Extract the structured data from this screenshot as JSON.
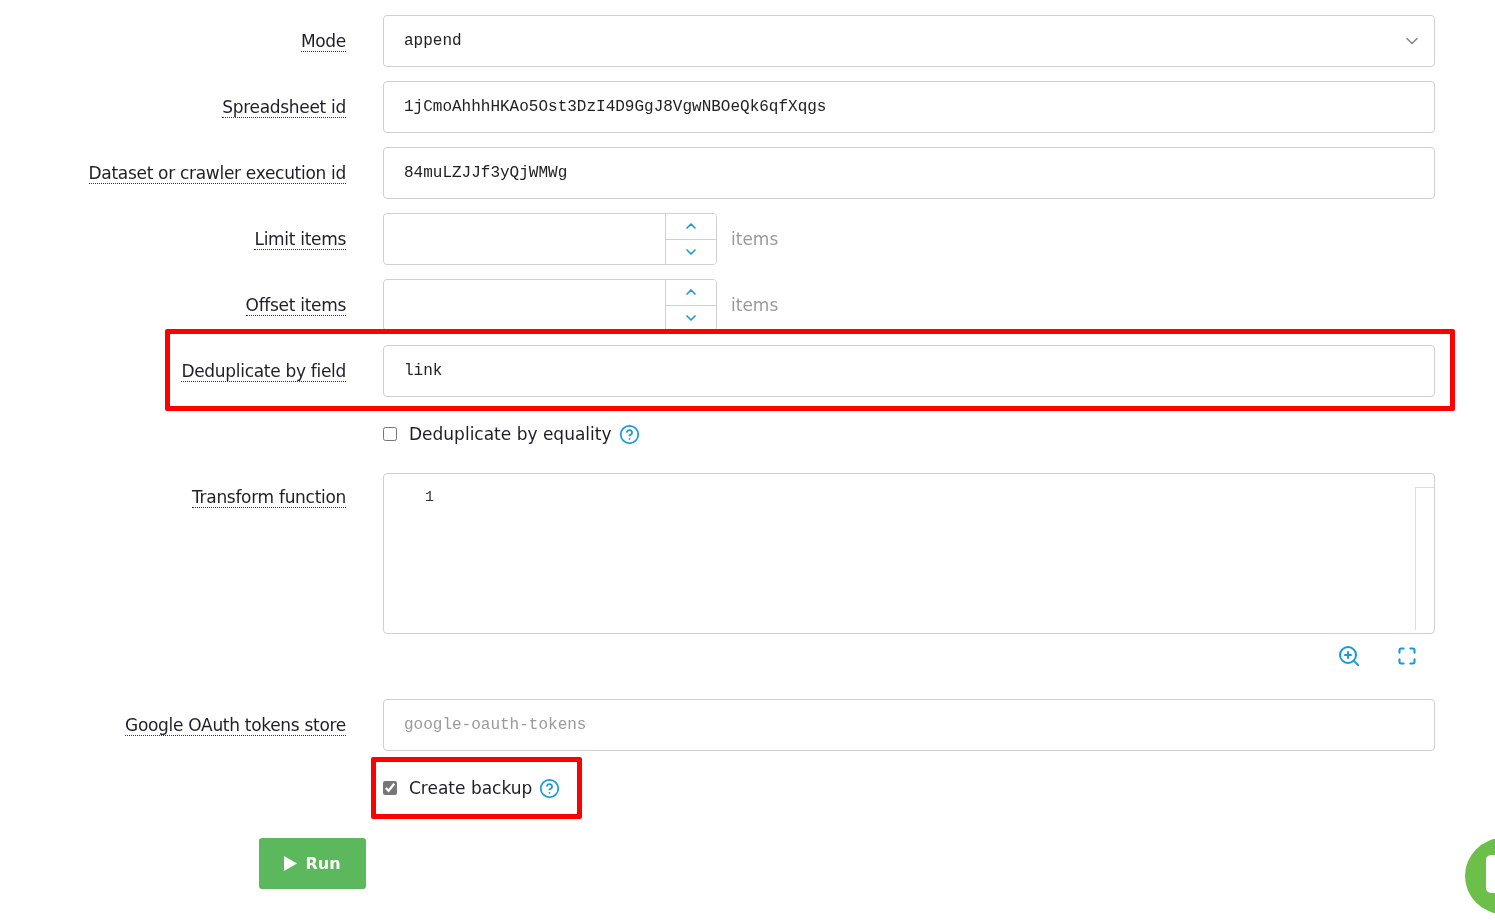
{
  "rows": [
    {
      "kind": "select",
      "label": "Mode",
      "value": "append",
      "highlighted": false
    },
    {
      "kind": "text",
      "label": "Spreadsheet id",
      "value": "1jCmoAhhhHKAo5Ost3DzI4D9GgJ8VgwNBOeQk6qfXqgs",
      "highlighted": false
    },
    {
      "kind": "text",
      "label": "Dataset or crawler execution id",
      "value": "84muLZJJf3yQjWMWg",
      "highlighted": false
    },
    {
      "kind": "number",
      "label": "Limit items",
      "unit": "items",
      "highlighted": false
    },
    {
      "kind": "number",
      "label": "Offset items",
      "unit": "items",
      "highlighted": false
    },
    {
      "kind": "text",
      "label": "Deduplicate by field",
      "value": "link",
      "highlighted": true
    },
    {
      "kind": "checkbox",
      "text": "Deduplicate by equality",
      "checked": false,
      "highlighted": false
    },
    {
      "kind": "code",
      "label": "Transform function",
      "line_numbers": [
        "1"
      ],
      "highlighted": false
    },
    {
      "kind": "text",
      "label": "Google OAuth tokens store",
      "placeholder": "google-oauth-tokens",
      "highlighted": false
    },
    {
      "kind": "checkbox",
      "text": "Create backup",
      "checked": true,
      "highlighted": true
    }
  ],
  "run_button": {
    "label": "Run"
  }
}
